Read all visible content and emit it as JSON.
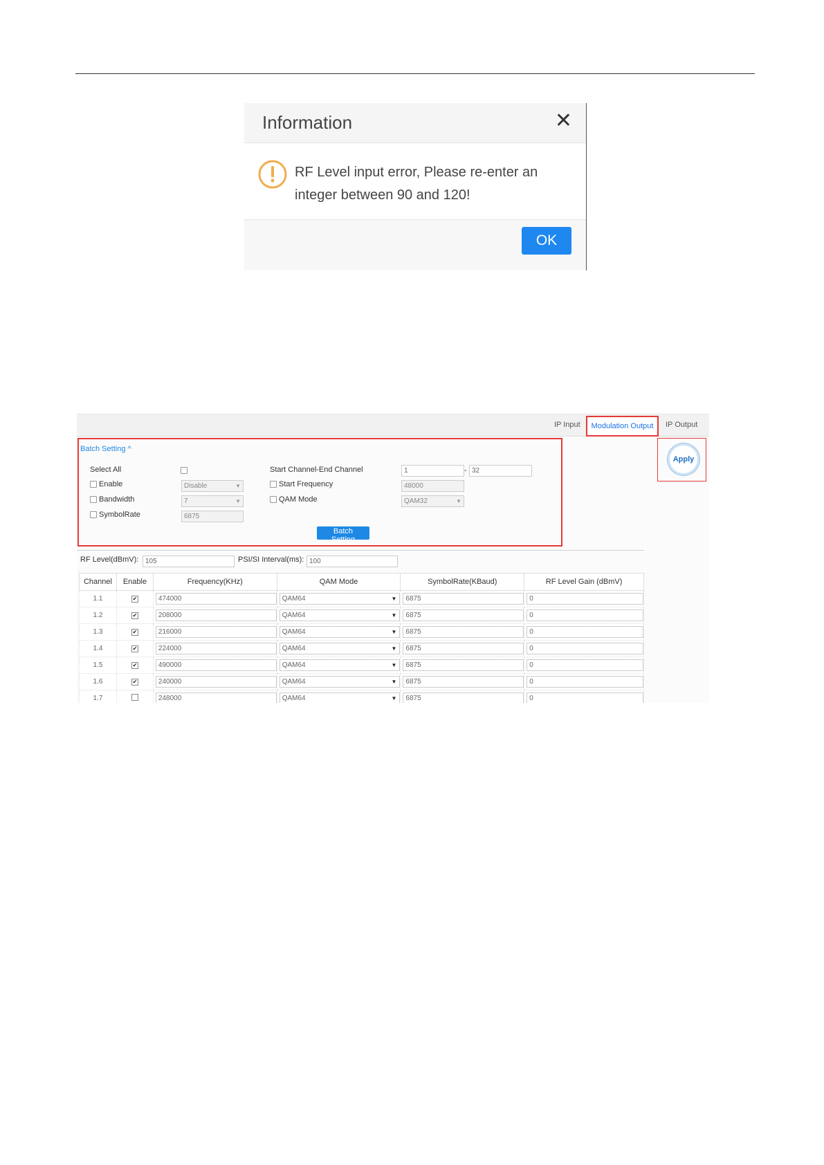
{
  "dialog": {
    "title": "Information",
    "message_line1": "RF Level input error, Please re-enter an",
    "message_line2": "integer between 90 and 120!",
    "ok_label": "OK",
    "icon": "warning-icon"
  },
  "tabs": {
    "ip_input": "IP Input",
    "modulation_output": "Modulation Output",
    "ip_output": "IP Output"
  },
  "batch": {
    "toggle_label": "Batch Setting ^",
    "select_all": "Select All",
    "enable": "Enable",
    "enable_value": "Disable",
    "bandwidth": "Bandwidth",
    "bandwidth_value": "7",
    "symbol_rate": "SymbolRate",
    "symbol_rate_value": "6875",
    "start_end_channel": "Start Channel-End Channel",
    "start_channel": "1",
    "range_sep": "-",
    "end_channel": "32",
    "start_frequency": "Start Frequency",
    "start_frequency_value": "48000",
    "qam_mode": "QAM Mode",
    "qam_mode_value": "QAM32",
    "button": "Batch Setting"
  },
  "apply_label": "Apply",
  "rf_level_label": "RF Level(dBmV):",
  "rf_level_value": "105",
  "psi_label": "PSI/SI Interval(ms):",
  "psi_value": "100",
  "table": {
    "headers": [
      "Channel",
      "Enable",
      "Frequency(KHz)",
      "QAM Mode",
      "SymbolRate(KBaud)",
      "RF Level Gain (dBmV)"
    ],
    "rows": [
      {
        "channel": "1.1",
        "enabled": "✔",
        "freq": "474000",
        "qam": "QAM64",
        "sr": "6875",
        "gain": "0"
      },
      {
        "channel": "1.2",
        "enabled": "✔",
        "freq": "208000",
        "qam": "QAM64",
        "sr": "6875",
        "gain": "0"
      },
      {
        "channel": "1.3",
        "enabled": "✔",
        "freq": "216000",
        "qam": "QAM64",
        "sr": "6875",
        "gain": "0"
      },
      {
        "channel": "1.4",
        "enabled": "✔",
        "freq": "224000",
        "qam": "QAM64",
        "sr": "6875",
        "gain": "0"
      },
      {
        "channel": "1.5",
        "enabled": "✔",
        "freq": "490000",
        "qam": "QAM64",
        "sr": "6875",
        "gain": "0"
      },
      {
        "channel": "1.6",
        "enabled": "✔",
        "freq": "240000",
        "qam": "QAM64",
        "sr": "6875",
        "gain": "0"
      },
      {
        "channel": "1.7",
        "enabled": "",
        "freq": "248000",
        "qam": "QAM64",
        "sr": "6875",
        "gain": "0"
      }
    ]
  }
}
